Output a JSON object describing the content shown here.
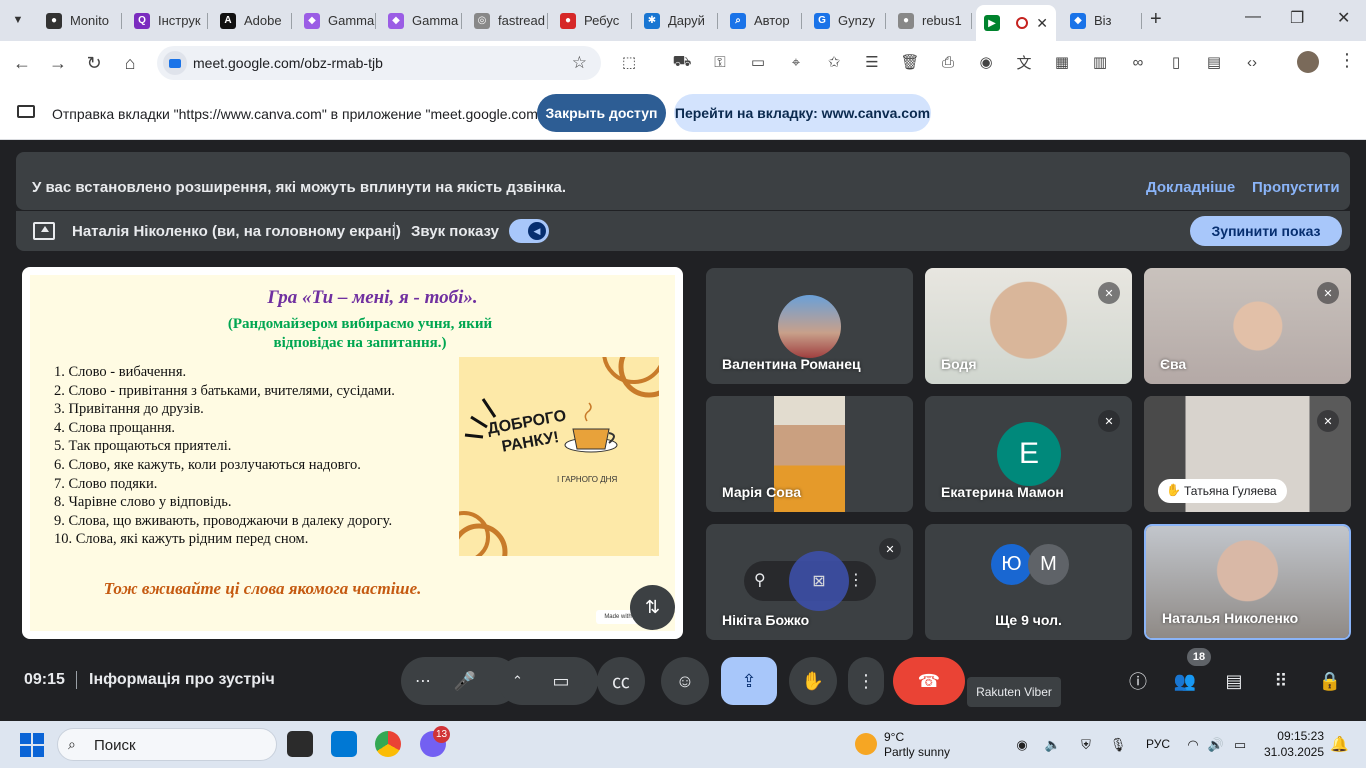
{
  "browser": {
    "tabs": [
      {
        "label": "Monito",
        "fav_color": "#333333",
        "fav_glyph": "●"
      },
      {
        "label": "Інструк",
        "fav_color": "#7b2cbf",
        "fav_glyph": "Q"
      },
      {
        "label": "Adobe",
        "fav_color": "#111111",
        "fav_glyph": "A"
      },
      {
        "label": "Gamma",
        "fav_color": "#9b5de5",
        "fav_glyph": "◆"
      },
      {
        "label": "Gamma",
        "fav_color": "#9b5de5",
        "fav_glyph": "◆"
      },
      {
        "label": "fastread",
        "fav_color": "#888888",
        "fav_glyph": "◎"
      },
      {
        "label": "Ребус",
        "fav_color": "#d62828",
        "fav_glyph": "●"
      },
      {
        "label": "Даруй",
        "fav_color": "#1976d2",
        "fav_glyph": "✱"
      },
      {
        "label": "Автор",
        "fav_color": "#1a73e8",
        "fav_glyph": "⌕"
      },
      {
        "label": "Gynzy",
        "fav_color": "#1a73e8",
        "fav_glyph": "G"
      },
      {
        "label": "rebus1",
        "fav_color": "#888888",
        "fav_glyph": "●"
      },
      {
        "label": "",
        "fav_color": "#00832d",
        "fav_glyph": "▶"
      },
      {
        "label": "Віз",
        "fav_color": "#1a73e8",
        "fav_glyph": "◆"
      }
    ],
    "new_tab": "+",
    "window_minimize": "—",
    "window_restore": "❐",
    "window_close": "✕",
    "url": "meet.google.com/obz-rmab-tjb"
  },
  "infobar": {
    "text": "Отправка вкладки \"https://www.canva.com\" в приложение \"meet.google.com\"...",
    "stop_access": "Закрыть доступ",
    "goto_tab": "Перейти на вкладку: www.canva.com"
  },
  "meet": {
    "ext_warning": "У вас встановлено розширення, які можуть вплинути на якість дзвінка.",
    "learn_more": "Докладніше",
    "skip": "Пропустити",
    "presenter": "Наталія Ніколенко (ви, на головному екрані)",
    "sound_label": "Звук показу",
    "stop_presenting": "Зупинити показ",
    "time": "09:15",
    "meeting_info": "Інформація про зустріч",
    "people_count": "18",
    "tooltip": "Rakuten Viber"
  },
  "slide": {
    "title": "Гра «Ти – мені, я - тобі».",
    "subtitle": "(Рандомайзером вибираємо учня, який відповідає на запитання.)",
    "items": [
      "1. Слово - вибачення.",
      "2.  Слово - привітання з батьками, вчителями, сусідами.",
      "3. Привітання до друзів.",
      "4. Слова прощання.",
      "5. Так прощаються приятелі.",
      "6. Слово, яке кажуть, коли розлучаються надовго.",
      "7. Слово подяки.",
      "8. Чарівне слово у відповідь.",
      "9. Слова, що вживають, проводжаючи в далеку дорогу.",
      "10. Слова, які кажуть рідним перед сном."
    ],
    "footer": "Тож вживайте ці слова якомога частіше.",
    "card_line1": "ДОБРОГО",
    "card_line2": "РАНКУ!",
    "card_small": "І ГАРНОГО ДНЯ",
    "made_with": "Made with"
  },
  "participants": [
    {
      "name": "Валентина Романец",
      "muted": false
    },
    {
      "name": "Бодя",
      "muted": true
    },
    {
      "name": "Єва",
      "muted": true
    },
    {
      "name": "Марія Сова",
      "muted": false
    },
    {
      "name": "Екатерина Мамон",
      "muted": true,
      "letter": "Е"
    },
    {
      "name": "Татьяна Гуляева",
      "muted": true
    },
    {
      "name": "Нікіта Божко",
      "muted": true
    },
    {
      "name": "Ще 9 чол.",
      "letters": [
        "Ю",
        "М"
      ]
    },
    {
      "name": "Наталья Николенко",
      "muted": false
    }
  ],
  "taskbar": {
    "search": "Поиск",
    "badge": "13",
    "weather_temp": "9°C",
    "weather_desc": "Partly sunny",
    "lang": "РУС",
    "clock_time": "09:15:23",
    "clock_date": "31.03.2025"
  },
  "colors": {
    "meet_bg": "#202124",
    "tile_bg": "#3c4043",
    "accent_blue": "#a8c7fa",
    "hangup_red": "#ea4335",
    "slide_title": "#7030a0",
    "slide_sub": "#00a651",
    "slide_foot": "#c55a11"
  }
}
